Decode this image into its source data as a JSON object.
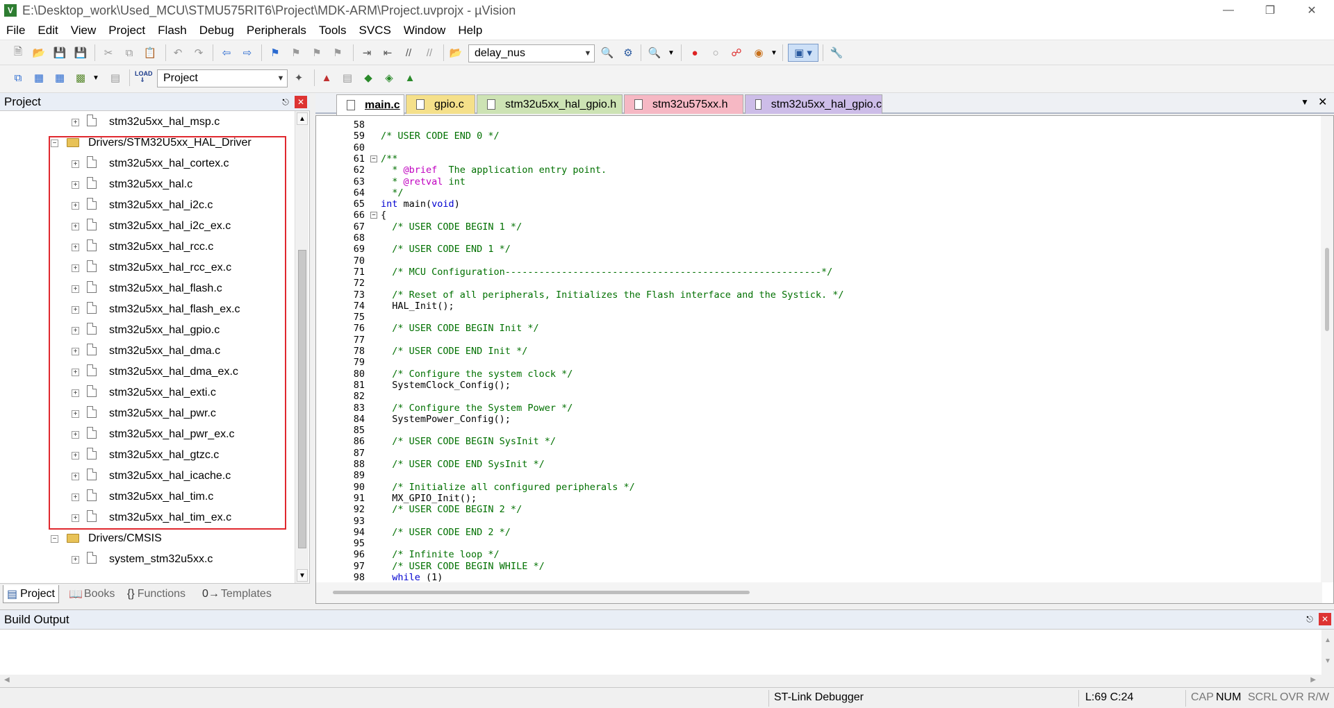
{
  "window": {
    "title": "E:\\Desktop_work\\Used_MCU\\STMU575RIT6\\Project\\MDK-ARM\\Project.uvprojx - µVision",
    "app_icon": "V"
  },
  "menu": [
    "File",
    "Edit",
    "View",
    "Project",
    "Flash",
    "Debug",
    "Peripherals",
    "Tools",
    "SVCS",
    "Window",
    "Help"
  ],
  "toolbar1": {
    "find_combo": "delay_nus"
  },
  "toolbar2": {
    "target_combo": "Project"
  },
  "project_panel": {
    "title": "Project",
    "tree": [
      {
        "label": "stm32u5xx_hal_msp.c",
        "type": "file",
        "level": 2
      },
      {
        "label": "Drivers/STM32U5xx_HAL_Driver",
        "type": "folder",
        "level": 1,
        "expanded": true
      },
      {
        "label": "stm32u5xx_hal_cortex.c",
        "type": "file",
        "level": 2
      },
      {
        "label": "stm32u5xx_hal.c",
        "type": "file",
        "level": 2
      },
      {
        "label": "stm32u5xx_hal_i2c.c",
        "type": "file",
        "level": 2
      },
      {
        "label": "stm32u5xx_hal_i2c_ex.c",
        "type": "file",
        "level": 2
      },
      {
        "label": "stm32u5xx_hal_rcc.c",
        "type": "file",
        "level": 2
      },
      {
        "label": "stm32u5xx_hal_rcc_ex.c",
        "type": "file",
        "level": 2
      },
      {
        "label": "stm32u5xx_hal_flash.c",
        "type": "file",
        "level": 2
      },
      {
        "label": "stm32u5xx_hal_flash_ex.c",
        "type": "file",
        "level": 2
      },
      {
        "label": "stm32u5xx_hal_gpio.c",
        "type": "file",
        "level": 2
      },
      {
        "label": "stm32u5xx_hal_dma.c",
        "type": "file",
        "level": 2
      },
      {
        "label": "stm32u5xx_hal_dma_ex.c",
        "type": "file",
        "level": 2
      },
      {
        "label": "stm32u5xx_hal_exti.c",
        "type": "file",
        "level": 2
      },
      {
        "label": "stm32u5xx_hal_pwr.c",
        "type": "file",
        "level": 2
      },
      {
        "label": "stm32u5xx_hal_pwr_ex.c",
        "type": "file",
        "level": 2
      },
      {
        "label": "stm32u5xx_hal_gtzc.c",
        "type": "file",
        "level": 2
      },
      {
        "label": "stm32u5xx_hal_icache.c",
        "type": "file",
        "level": 2
      },
      {
        "label": "stm32u5xx_hal_tim.c",
        "type": "file",
        "level": 2
      },
      {
        "label": "stm32u5xx_hal_tim_ex.c",
        "type": "file",
        "level": 2
      },
      {
        "label": "Drivers/CMSIS",
        "type": "folder",
        "level": 1,
        "expanded": true
      },
      {
        "label": "system_stm32u5xx.c",
        "type": "file",
        "level": 2
      }
    ],
    "tabs": [
      "Project",
      "Books",
      "Functions",
      "Templates"
    ],
    "tab_icons": [
      "project-icon",
      "books-icon",
      "functions-icon",
      "templates-icon"
    ]
  },
  "editor_tabs": [
    {
      "label": "main.c",
      "active": true,
      "color": "#ffffff"
    },
    {
      "label": "gpio.c",
      "active": false,
      "color": "#f5e08a"
    },
    {
      "label": "stm32u5xx_hal_gpio.h",
      "active": false,
      "color": "#cde3b4"
    },
    {
      "label": "stm32u575xx.h",
      "active": false,
      "color": "#f6b8c4"
    },
    {
      "label": "stm32u5xx_hal_gpio.c",
      "active": false,
      "color": "#cdbde8"
    }
  ],
  "code_lines": [
    {
      "n": "58",
      "fold": "",
      "parts": []
    },
    {
      "n": "59",
      "fold": "",
      "parts": [
        {
          "t": "/* USER CODE END 0 */",
          "c": "comment"
        }
      ]
    },
    {
      "n": "60",
      "fold": "",
      "parts": []
    },
    {
      "n": "61",
      "fold": "minus",
      "parts": [
        {
          "t": "/**",
          "c": "comment"
        }
      ]
    },
    {
      "n": "62",
      "fold": "",
      "parts": [
        {
          "t": "  * ",
          "c": "comment"
        },
        {
          "t": "@brief",
          "c": "tag"
        },
        {
          "t": "  The application entry point.",
          "c": "comment"
        }
      ]
    },
    {
      "n": "63",
      "fold": "",
      "parts": [
        {
          "t": "  * ",
          "c": "comment"
        },
        {
          "t": "@retval",
          "c": "tag"
        },
        {
          "t": " int",
          "c": "comment"
        }
      ]
    },
    {
      "n": "64",
      "fold": "",
      "parts": [
        {
          "t": "  */",
          "c": "comment"
        }
      ]
    },
    {
      "n": "65",
      "fold": "",
      "parts": [
        {
          "t": "int",
          "c": "kw"
        },
        {
          "t": " main(",
          "c": ""
        },
        {
          "t": "void",
          "c": "kw"
        },
        {
          "t": ")",
          "c": ""
        }
      ]
    },
    {
      "n": "66",
      "fold": "minus",
      "parts": [
        {
          "t": "{",
          "c": ""
        }
      ]
    },
    {
      "n": "67",
      "fold": "",
      "parts": [
        {
          "t": "  /* USER CODE BEGIN 1 */",
          "c": "comment"
        }
      ]
    },
    {
      "n": "68",
      "fold": "",
      "parts": []
    },
    {
      "n": "69",
      "fold": "",
      "parts": [
        {
          "t": "  /* USER CODE END 1 */",
          "c": "comment"
        }
      ]
    },
    {
      "n": "70",
      "fold": "",
      "parts": []
    },
    {
      "n": "71",
      "fold": "",
      "parts": [
        {
          "t": "  /* MCU Configuration--------------------------------------------------------*/",
          "c": "comment"
        }
      ]
    },
    {
      "n": "72",
      "fold": "",
      "parts": []
    },
    {
      "n": "73",
      "fold": "",
      "parts": [
        {
          "t": "  /* Reset of all peripherals, Initializes the Flash interface and the Systick. */",
          "c": "comment"
        }
      ]
    },
    {
      "n": "74",
      "fold": "",
      "parts": [
        {
          "t": "  HAL_Init();",
          "c": ""
        }
      ]
    },
    {
      "n": "75",
      "fold": "",
      "parts": []
    },
    {
      "n": "76",
      "fold": "",
      "parts": [
        {
          "t": "  /* USER CODE BEGIN Init */",
          "c": "comment"
        }
      ]
    },
    {
      "n": "77",
      "fold": "",
      "parts": []
    },
    {
      "n": "78",
      "fold": "",
      "parts": [
        {
          "t": "  /* USER CODE END Init */",
          "c": "comment"
        }
      ]
    },
    {
      "n": "79",
      "fold": "",
      "parts": []
    },
    {
      "n": "80",
      "fold": "",
      "parts": [
        {
          "t": "  /* Configure the system clock */",
          "c": "comment"
        }
      ]
    },
    {
      "n": "81",
      "fold": "",
      "parts": [
        {
          "t": "  SystemClock_Config();",
          "c": ""
        }
      ]
    },
    {
      "n": "82",
      "fold": "",
      "parts": []
    },
    {
      "n": "83",
      "fold": "",
      "parts": [
        {
          "t": "  /* Configure the System Power */",
          "c": "comment"
        }
      ]
    },
    {
      "n": "84",
      "fold": "",
      "parts": [
        {
          "t": "  SystemPower_Config();",
          "c": ""
        }
      ]
    },
    {
      "n": "85",
      "fold": "",
      "parts": []
    },
    {
      "n": "86",
      "fold": "",
      "parts": [
        {
          "t": "  /* USER CODE BEGIN SysInit */",
          "c": "comment"
        }
      ]
    },
    {
      "n": "87",
      "fold": "",
      "parts": []
    },
    {
      "n": "88",
      "fold": "",
      "parts": [
        {
          "t": "  /* USER CODE END SysInit */",
          "c": "comment"
        }
      ]
    },
    {
      "n": "89",
      "fold": "",
      "parts": []
    },
    {
      "n": "90",
      "fold": "",
      "parts": [
        {
          "t": "  /* Initialize all configured peripherals */",
          "c": "comment"
        }
      ]
    },
    {
      "n": "91",
      "fold": "",
      "parts": [
        {
          "t": "  MX_GPIO_Init();",
          "c": ""
        }
      ]
    },
    {
      "n": "92",
      "fold": "",
      "parts": [
        {
          "t": "  /* USER CODE BEGIN 2 */",
          "c": "comment"
        }
      ]
    },
    {
      "n": "93",
      "fold": "",
      "parts": []
    },
    {
      "n": "94",
      "fold": "",
      "parts": [
        {
          "t": "  /* USER CODE END 2 */",
          "c": "comment"
        }
      ]
    },
    {
      "n": "95",
      "fold": "",
      "parts": []
    },
    {
      "n": "96",
      "fold": "",
      "parts": [
        {
          "t": "  /* Infinite loop */",
          "c": "comment"
        }
      ]
    },
    {
      "n": "97",
      "fold": "",
      "parts": [
        {
          "t": "  /* USER CODE BEGIN WHILE */",
          "c": "comment"
        }
      ]
    },
    {
      "n": "98",
      "fold": "",
      "parts": [
        {
          "t": "  ",
          "c": ""
        },
        {
          "t": "while",
          "c": "kw"
        },
        {
          "t": " (1)",
          "c": ""
        }
      ]
    }
  ],
  "build_output": {
    "title": "Build Output"
  },
  "status": {
    "debugger": "ST-Link Debugger",
    "position": "L:69 C:24",
    "cap": "CAP",
    "num": "NUM",
    "scrl": "SCRL",
    "ovr": "OVR",
    "rw": "R/W"
  }
}
